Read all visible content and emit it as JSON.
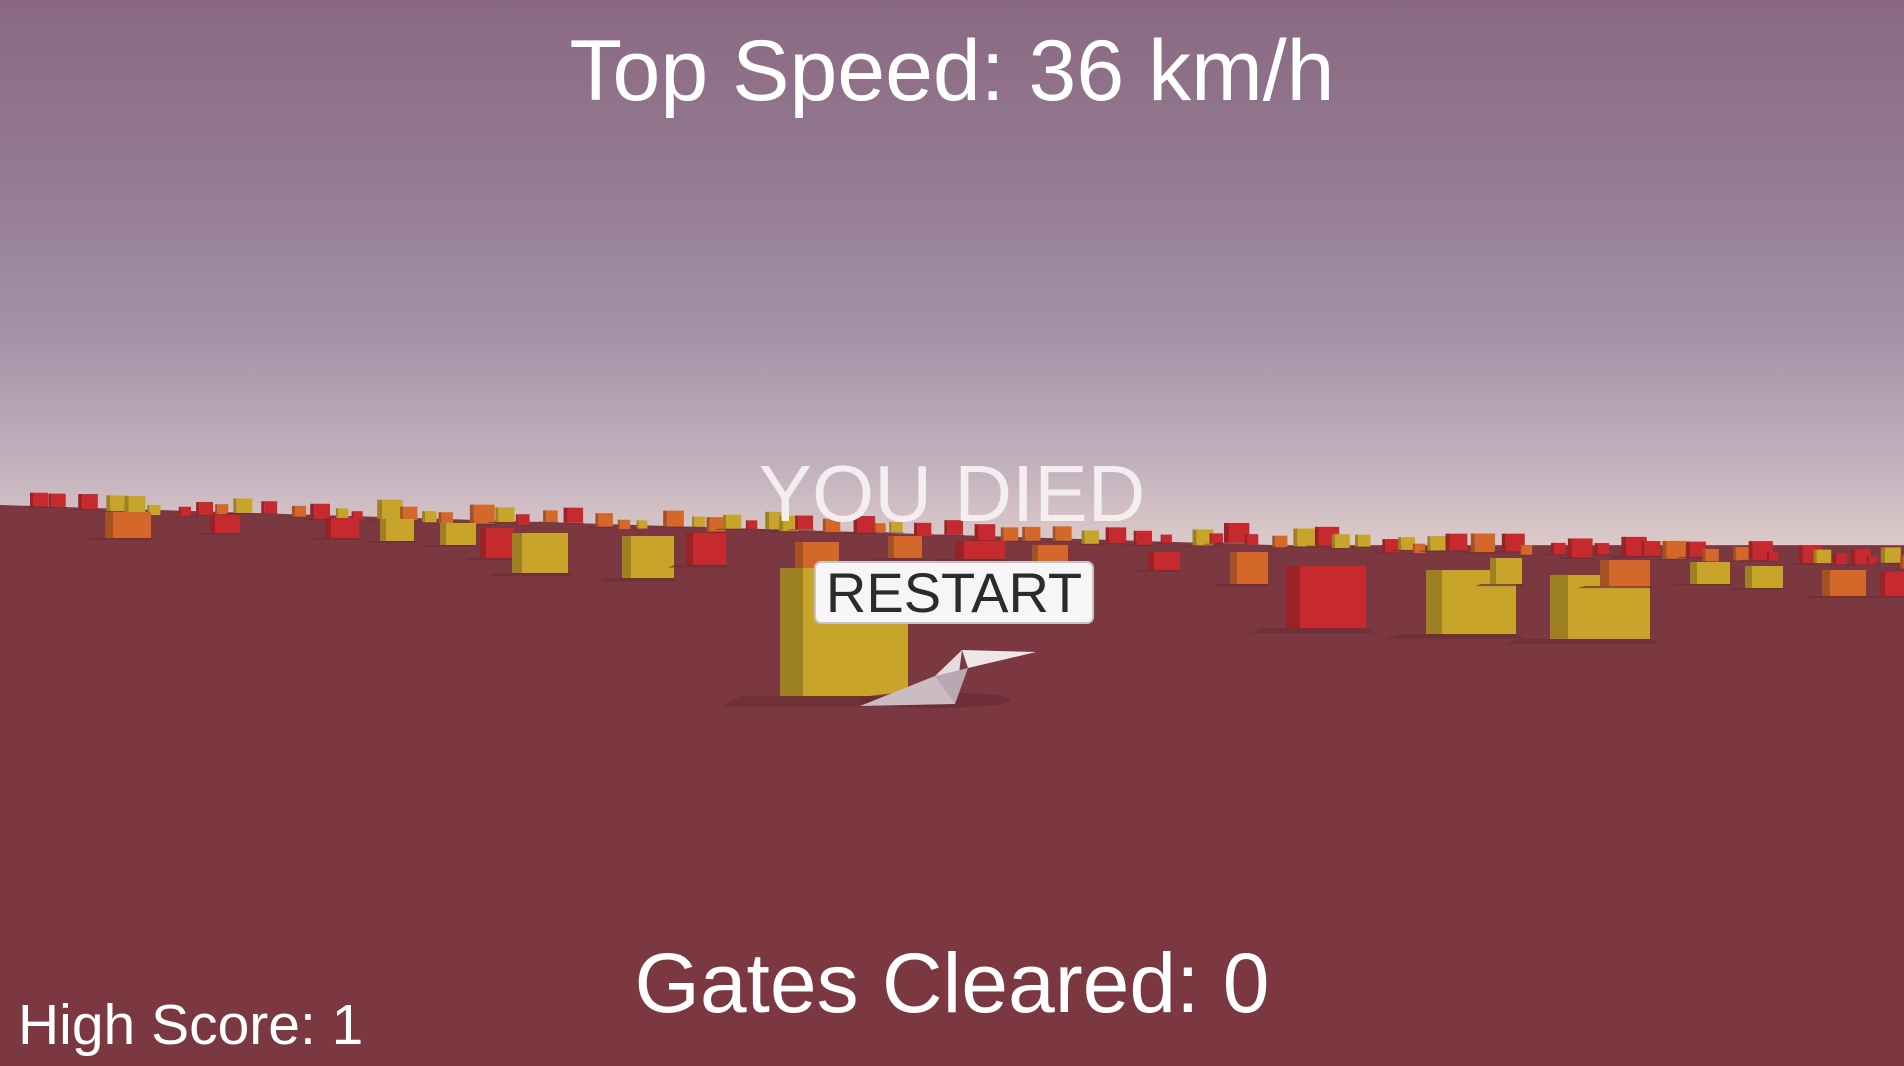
{
  "hud": {
    "top_speed": "Top Speed: 36 km/h",
    "game_over": "YOU DIED",
    "restart_label": "RESTART",
    "gates_cleared": "Gates Cleared: 0",
    "high_score": "High Score: 1"
  },
  "colors": {
    "sky_top": "#8a6882",
    "horizon": "#dccaca",
    "ground": "#7b3840",
    "cube_yellow": "#c9a42a",
    "cube_red": "#c62a2e",
    "cube_orange": "#d3682a",
    "glider": "#e2d4da"
  },
  "scene_objects": {
    "player": "paper-glider",
    "obstacles": [
      "yellow-cube",
      "red-cube",
      "orange-cube"
    ]
  }
}
